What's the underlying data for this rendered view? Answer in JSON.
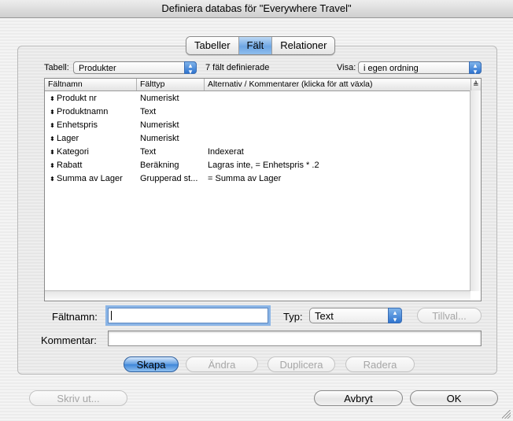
{
  "window": {
    "title": "Definiera databas för \"Everywhere Travel\""
  },
  "tabs": [
    {
      "label": "Tabeller",
      "active": false
    },
    {
      "label": "Fält",
      "active": true
    },
    {
      "label": "Relationer",
      "active": false
    }
  ],
  "table_selector": {
    "label": "Tabell:",
    "value": "Produkter"
  },
  "field_count": "7 fält definierade",
  "view_selector": {
    "label": "Visa:",
    "value": "i egen ordning"
  },
  "grid": {
    "headers": [
      "Fältnamn",
      "Fälttyp",
      "Alternativ / Kommentarer (klicka för att växla)"
    ],
    "rows": [
      {
        "name": "Produkt nr",
        "type": "Numeriskt",
        "options": ""
      },
      {
        "name": "Produktnamn",
        "type": "Text",
        "options": ""
      },
      {
        "name": "Enhetspris",
        "type": "Numeriskt",
        "options": ""
      },
      {
        "name": "Lager",
        "type": "Numeriskt",
        "options": ""
      },
      {
        "name": "Kategori",
        "type": "Text",
        "options": "Indexerat"
      },
      {
        "name": "Rabatt",
        "type": "Beräkning",
        "options": "Lagras inte, = Enhetspris * .2"
      },
      {
        "name": "Summa av Lager",
        "type": "Grupperad st...",
        "options": "= Summa av Lager"
      }
    ]
  },
  "form": {
    "field_name_label": "Fältnamn:",
    "field_name_value": "",
    "type_label": "Typ:",
    "type_value": "Text",
    "options_button": "Tillval...",
    "comment_label": "Kommentar:",
    "comment_value": ""
  },
  "actions": {
    "create": "Skapa",
    "change": "Ändra",
    "duplicate": "Duplicera",
    "delete": "Radera"
  },
  "footer": {
    "print": "Skriv ut...",
    "cancel": "Avbryt",
    "ok": "OK"
  },
  "colors": {
    "selection_blue": "#3e86d8"
  }
}
